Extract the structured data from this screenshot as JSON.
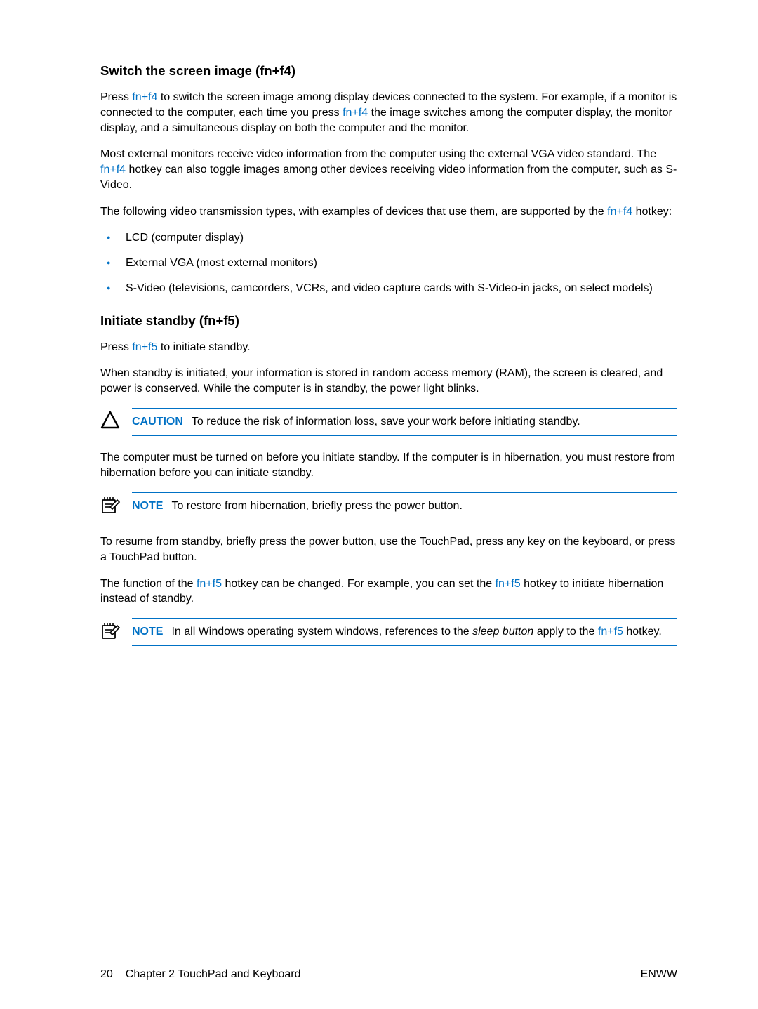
{
  "section1": {
    "heading": "Switch the screen image (fn+f4)",
    "p1": {
      "pre": "Press ",
      "key1": "fn+f4",
      "mid": " to switch the screen image among display devices connected to the system. For example, if a monitor is connected to the computer, each time you press ",
      "key2": "fn+f4",
      "post": " the image switches among the computer display, the monitor display, and a simultaneous display on both the computer and the monitor."
    },
    "p2": {
      "pre": "Most external monitors receive video information from the computer using the external VGA video standard. The ",
      "key": "fn+f4",
      "post": " hotkey can also toggle images among other devices receiving video information from the computer, such as S-Video."
    },
    "p3": {
      "pre": "The following video transmission types, with examples of devices that use them, are supported by the ",
      "key": "fn+f4",
      "post": " hotkey:"
    },
    "bullets": [
      "LCD (computer display)",
      "External VGA (most external monitors)",
      "S-Video (televisions, camcorders, VCRs, and video capture cards with S-Video-in jacks, on select models)"
    ]
  },
  "section2": {
    "heading": "Initiate standby (fn+f5)",
    "p1": {
      "pre": "Press ",
      "key": "fn+f5",
      "post": " to initiate standby."
    },
    "p2": "When standby is initiated, your information is stored in random access memory (RAM), the screen is cleared, and power is conserved. While the computer is in standby, the power light blinks.",
    "caution": {
      "label": "CAUTION",
      "text": "To reduce the risk of information loss, save your work before initiating standby."
    },
    "p3": "The computer must be turned on before you initiate standby. If the computer is in hibernation, you must restore from hibernation before you can initiate standby.",
    "note1": {
      "label": "NOTE",
      "text": "To restore from hibernation, briefly press the power button."
    },
    "p4": "To resume from standby, briefly press the power button, use the TouchPad, press any key on the keyboard, or press a TouchPad button.",
    "p5": {
      "pre": "The function of the ",
      "key1": "fn+f5",
      "mid": " hotkey can be changed. For example, you can set the ",
      "key2": "fn+f5",
      "post": " hotkey to initiate hibernation instead of standby."
    },
    "note2": {
      "label": "NOTE",
      "pre": "In all Windows operating system windows, references to the ",
      "italic": "sleep button",
      "mid": " apply to the ",
      "key": "fn+f5",
      "post": " hotkey."
    }
  },
  "footer": {
    "pageNum": "20",
    "chapter": "Chapter 2   TouchPad and Keyboard",
    "right": "ENWW"
  }
}
